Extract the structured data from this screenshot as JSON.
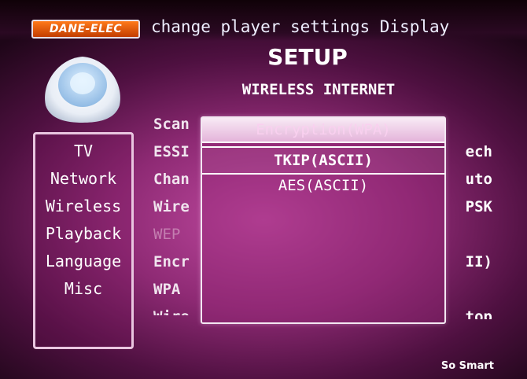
{
  "header": {
    "logo_text": "DANE-ELEC",
    "help_text": "change player settings  Display",
    "page_title": "SETUP",
    "section_title": "WIRELESS INTERNET"
  },
  "sidebar": {
    "items": [
      {
        "label": "TV"
      },
      {
        "label": "Network"
      },
      {
        "label": "Wireless"
      },
      {
        "label": "Playback"
      },
      {
        "label": "Language"
      },
      {
        "label": "Misc"
      }
    ]
  },
  "settings": {
    "rows": [
      {
        "label": "Scan",
        "enabled": true
      },
      {
        "label": "ESSI",
        "enabled": true
      },
      {
        "label": "Chan",
        "enabled": true
      },
      {
        "label": "Wire",
        "enabled": true
      },
      {
        "label": "WEP",
        "enabled": false
      },
      {
        "label": "Encr",
        "enabled": true
      },
      {
        "label": "WPA",
        "enabled": true
      },
      {
        "label": "Wire",
        "enabled": true
      }
    ],
    "values": [
      "ech",
      "uto",
      "PSK",
      "",
      "II)",
      "",
      "top"
    ]
  },
  "dropdown": {
    "header": "Encryption(WPA)",
    "options": [
      "TKIP(ASCII)",
      "AES(ASCII)"
    ],
    "selected_index": 0
  },
  "footer": {
    "tagline": "So Smart"
  },
  "colors": {
    "background": "#8e2a74",
    "logo": "#e2590c",
    "panel_border": "#e9c6e0"
  }
}
